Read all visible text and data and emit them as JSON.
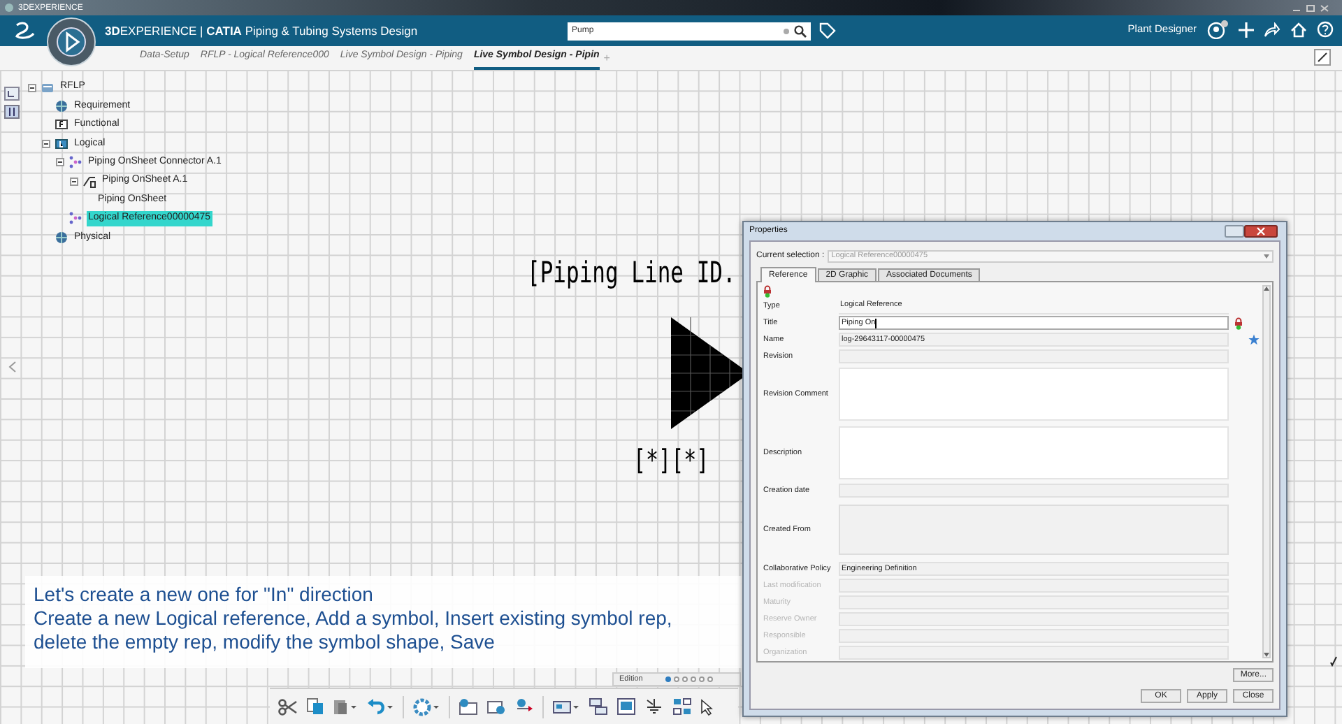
{
  "window": {
    "title": "3DEXPERIENCE"
  },
  "top_bar": {
    "brand": "**3D**EXPERIENCE | **CATIA** Piping & Tubing Systems Design",
    "search": {
      "value": "Pump"
    },
    "user": "Plant Designer"
  },
  "tabs": [
    {
      "label": "Data-Setup",
      "selected": false
    },
    {
      "label": "RFLP - Logical Reference000",
      "selected": false
    },
    {
      "label": "Live Symbol Design - Piping",
      "selected": false
    },
    {
      "label": "Live Symbol Design - Pipin",
      "selected": true
    }
  ],
  "tab_add": "+",
  "tree": [
    {
      "label": "RFLP",
      "kind": "root",
      "selected": false,
      "expanded": true,
      "children": [
        {
          "label": "Requirement",
          "kind": "globe",
          "selected": false
        },
        {
          "label": "Functional",
          "kind": "functional",
          "selected": false
        },
        {
          "label": "Logical",
          "kind": "logical",
          "selected": false,
          "expanded": true,
          "children": [
            {
              "label": "Piping OnSheet Connector A.1",
              "kind": "dots",
              "selected": false,
              "expanded": true,
              "children": [
                {
                  "label": "Piping OnSheet A.1",
                  "kind": "pipe",
                  "selected": false,
                  "expanded": true,
                  "children": [
                    {
                      "label": "Piping OnSheet",
                      "selected": false
                    }
                  ]
                }
              ]
            },
            {
              "label": "Logical Reference00000475",
              "kind": "dots",
              "selected": true
            }
          ]
        },
        {
          "label": "Physical",
          "kind": "globe",
          "selected": false
        }
      ]
    }
  ],
  "symbol": {
    "label": "[Piping Line ID.",
    "tag": "[*][*]"
  },
  "caption": [
    "Let's create a new one for \"In\" direction",
    "Create a new Logical reference, Add a symbol, Insert existing symbol rep,",
    "delete the empty rep, modify the symbol shape, Save"
  ],
  "dialog": {
    "title": "Properties",
    "selection_label": "Current selection :",
    "selection_value": "Logical Reference00000475",
    "tabs": [
      {
        "label": "Reference",
        "selected": true
      },
      {
        "label": "2D Graphic",
        "selected": false
      },
      {
        "label": "Associated Documents",
        "selected": false
      }
    ],
    "fields": [
      {
        "label": "Type",
        "kind": "plain",
        "value": "Logical Reference",
        "disabled": false
      },
      {
        "label": "Title",
        "kind": "input",
        "value": "Piping On",
        "disabled": false
      },
      {
        "label": "Name",
        "kind": "readonly",
        "value": "log-29643117-00000475",
        "disabled": false
      },
      {
        "label": "Revision",
        "kind": "readonly",
        "disabled": false
      },
      {
        "label": "Revision Comment",
        "kind": "area",
        "disabled": false
      },
      {
        "label": "Description",
        "kind": "area",
        "disabled": false
      },
      {
        "label": "Creation date",
        "kind": "readonly",
        "disabled": false
      },
      {
        "label": "Created From",
        "kind": "tall",
        "disabled": false
      },
      {
        "label": "Collaborative Policy",
        "kind": "readonly",
        "value": "Engineering Definition",
        "disabled": false
      },
      {
        "label": "Last modification",
        "kind": "readonly",
        "disabled": true
      },
      {
        "label": "Maturity",
        "kind": "readonly",
        "disabled": true
      },
      {
        "label": "Reserve Owner",
        "kind": "readonly",
        "disabled": true
      },
      {
        "label": "Responsible",
        "kind": "readonly",
        "disabled": true
      },
      {
        "label": "Organization",
        "kind": "readonly",
        "disabled": true
      }
    ],
    "more_button": "More...",
    "buttons": [
      "OK",
      "Apply",
      "Close"
    ]
  },
  "pager": {
    "label": "Edition",
    "pages": [
      {
        "selected": true
      },
      {
        "selected": false
      },
      {
        "selected": false
      },
      {
        "selected": false
      },
      {
        "selected": false
      },
      {
        "selected": false
      }
    ]
  }
}
